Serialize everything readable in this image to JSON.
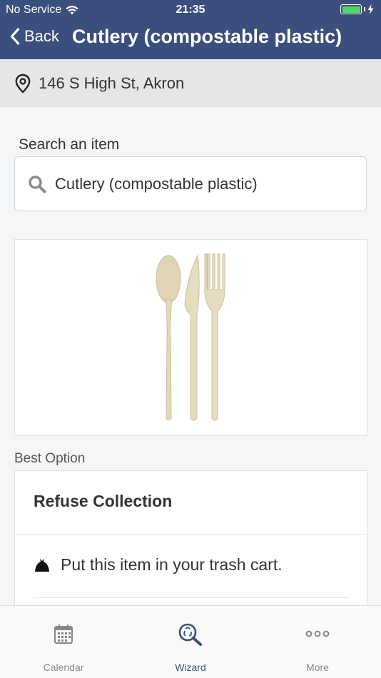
{
  "status_bar": {
    "carrier": "No Service",
    "time": "21:35"
  },
  "nav": {
    "back_label": "Back",
    "title": "Cutlery (compostable plastic)"
  },
  "address": {
    "text": "146 S High St, Akron"
  },
  "search": {
    "label": "Search an item",
    "value": "Cutlery (compostable plastic)"
  },
  "item_image": {
    "icon": "compostable-cutlery-image"
  },
  "best_option": {
    "label": "Best Option",
    "title": "Refuse Collection",
    "instruction": "Put this item in your trash cart."
  },
  "tabs": [
    {
      "label": "Calendar",
      "icon": "calendar-icon",
      "active": false
    },
    {
      "label": "Wizard",
      "icon": "recycle-search-icon",
      "active": true
    },
    {
      "label": "More",
      "icon": "more-dots-icon",
      "active": false
    }
  ],
  "colors": {
    "header": "#3b4f7e",
    "battery": "#4cd964",
    "active_tab": "#3b4f7e"
  }
}
